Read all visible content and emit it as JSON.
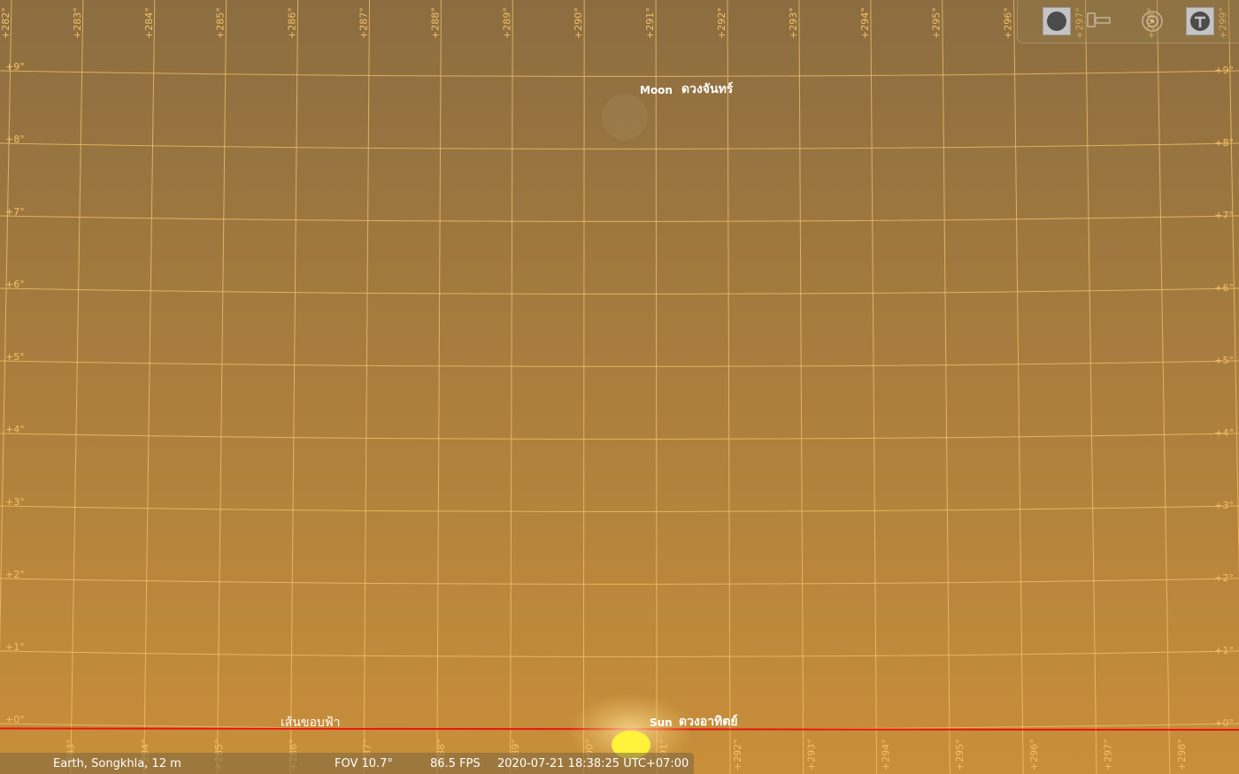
{
  "sky": {
    "colors": {
      "sky_top": "#8c6d41",
      "sky_bottom": "#c98f3a",
      "grid_line": "#f6c66a",
      "grid_label": "#f5c067",
      "horizon_line": "#e8150f",
      "sun_disk": "#fff23a",
      "label_white": "#ffffff"
    },
    "azimuth_labels": [
      "+282°",
      "+283°",
      "+284°",
      "+285°",
      "+286°",
      "+287°",
      "+288°",
      "+289°",
      "+290°",
      "+291°",
      "+292°",
      "+293°",
      "+294°",
      "+295°",
      "+296°",
      "+297°",
      "+298°",
      "+299°"
    ],
    "altitude_labels": [
      "+9°",
      "+8°",
      "+7°",
      "+6°",
      "+5°",
      "+4°",
      "+3°",
      "+2°",
      "+1°",
      "+0°"
    ],
    "horizon_label": "เส้นขอบฟ้า",
    "moon": {
      "name_en": "Moon",
      "name_th": "ดวงจันทร์"
    },
    "sun": {
      "name_en": "Sun",
      "name_th": "ดวงอาทิตย์"
    }
  },
  "toolbar": {
    "buttons": [
      {
        "icon": "planet-disk-icon",
        "active": true
      },
      {
        "icon": "telescope-icon",
        "active": false
      },
      {
        "icon": "target-icon",
        "active": false
      },
      {
        "icon": "wrench-icon",
        "active": true
      }
    ]
  },
  "status": {
    "location": "Earth, Songkhla, 12 m",
    "fov": "FOV 10.7°",
    "fps": "86.5 FPS",
    "datetime": "2020-07-21 18:38:25 UTC+07:00"
  }
}
